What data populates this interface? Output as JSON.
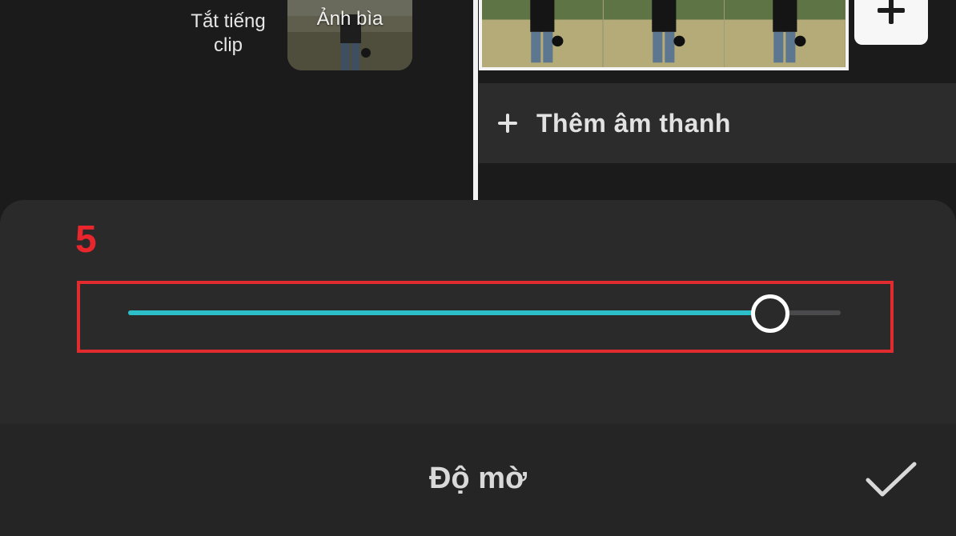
{
  "editor": {
    "mute_clip_label": "Tắt tiếng clip",
    "cover_label": "Ảnh bìa",
    "add_audio_label": "Thêm âm thanh",
    "timeline_frames": 3
  },
  "annotation": {
    "step_number": "5",
    "color": "#e02b2f"
  },
  "blur_panel": {
    "title": "Độ mờ",
    "slider_level": 0.9,
    "accent_color": "#2cbfc9",
    "confirm_icon": "checkmark-icon"
  },
  "icons": {
    "add_clip": "plus-icon",
    "add_audio": "plus-icon",
    "cover_edit": "image-edit-icon"
  }
}
